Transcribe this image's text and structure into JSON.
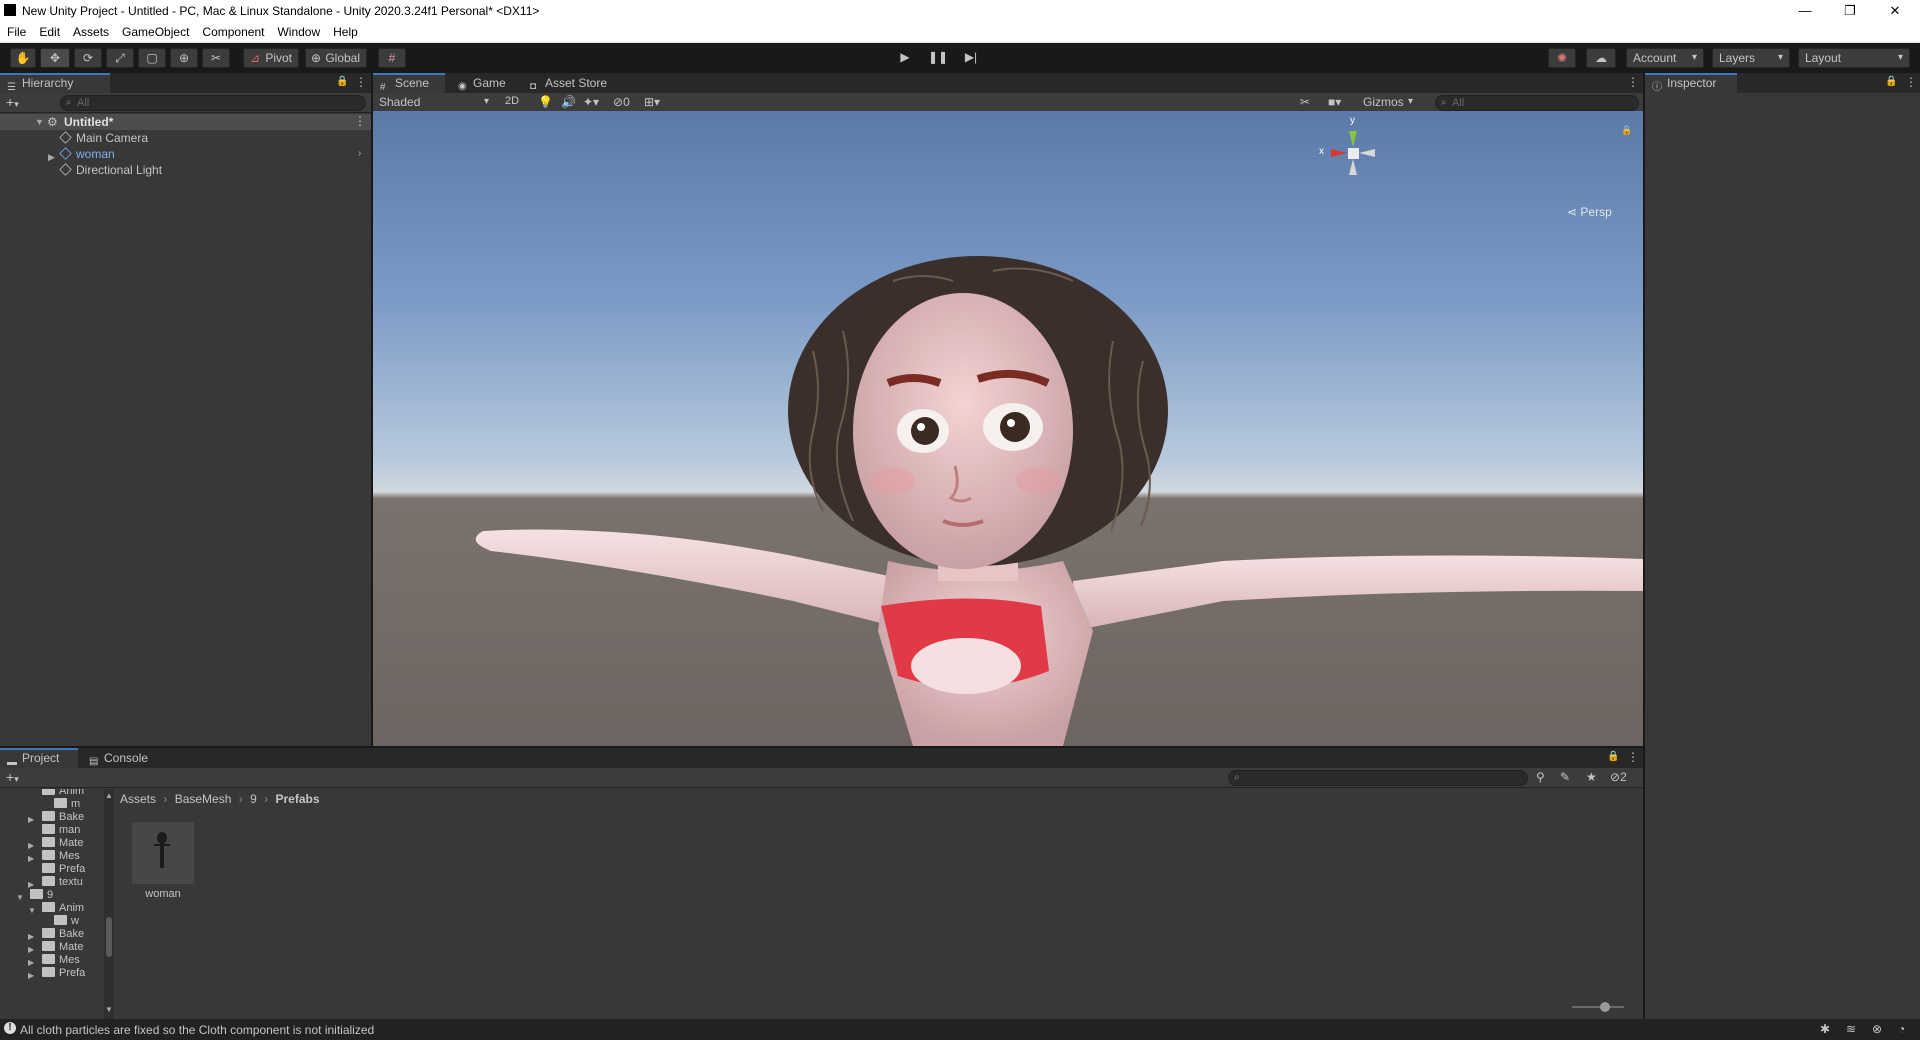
{
  "window": {
    "title": "New Unity Project - Untitled - PC, Mac & Linux Standalone - Unity 2020.3.24f1 Personal* <DX11>",
    "minimize": "—",
    "maximize": "❐",
    "close": "✕"
  },
  "menu": [
    "File",
    "Edit",
    "Assets",
    "GameObject",
    "Component",
    "Window",
    "Help"
  ],
  "toolbar": {
    "pivot_label": "Pivot",
    "global_label": "Global",
    "account_label": "Account",
    "layers_label": "Layers",
    "layout_label": "Layout"
  },
  "hierarchy": {
    "tab_label": "Hierarchy",
    "search_placeholder": "All",
    "scene_name": "Untitled*",
    "items": [
      "Main Camera",
      "woman",
      "Directional Light"
    ]
  },
  "scene": {
    "tabs": [
      "Scene",
      "Game",
      "Asset Store"
    ],
    "shading_mode": "Shaded",
    "mode_2d": "2D",
    "hidden_count": "0",
    "gizmos_label": "Gizmos",
    "search_placeholder": "All",
    "projection_label": "Persp",
    "axis_labels": {
      "x": "x",
      "y": "y"
    }
  },
  "inspector": {
    "tab_label": "Inspector"
  },
  "project": {
    "tabs": [
      "Project",
      "Console"
    ],
    "hidden_count": "2",
    "breadcrumb": [
      "Assets",
      "BaseMesh",
      "9",
      "Prefabs"
    ],
    "tree": [
      {
        "label": "Anim",
        "indent": 3,
        "type": "folder",
        "arrow": ""
      },
      {
        "label": "m",
        "indent": 4,
        "type": "folder",
        "arrow": ""
      },
      {
        "label": "Bake",
        "indent": 3,
        "type": "folder",
        "arrow": "▶"
      },
      {
        "label": "man",
        "indent": 3,
        "type": "folder",
        "arrow": ""
      },
      {
        "label": "Mate",
        "indent": 3,
        "type": "folder",
        "arrow": "▶"
      },
      {
        "label": "Mes",
        "indent": 3,
        "type": "folder",
        "arrow": "▶"
      },
      {
        "label": "Prefa",
        "indent": 3,
        "type": "folder",
        "arrow": ""
      },
      {
        "label": "textu",
        "indent": 3,
        "type": "folder",
        "arrow": "▶"
      },
      {
        "label": "9",
        "indent": 2,
        "type": "folder",
        "arrow": "▼"
      },
      {
        "label": "Anim",
        "indent": 3,
        "type": "folder",
        "arrow": "▼"
      },
      {
        "label": "w",
        "indent": 4,
        "type": "folder",
        "arrow": ""
      },
      {
        "label": "Bake",
        "indent": 3,
        "type": "folder",
        "arrow": "▶"
      },
      {
        "label": "Mate",
        "indent": 3,
        "type": "folder",
        "arrow": "▶"
      },
      {
        "label": "Mes",
        "indent": 3,
        "type": "folder",
        "arrow": "▶"
      },
      {
        "label": "Prefa",
        "indent": 3,
        "type": "folder",
        "arrow": "▶"
      }
    ],
    "assets": [
      {
        "name": "woman"
      }
    ]
  },
  "status": {
    "message": "All cloth particles are fixed so the Cloth component is not initialized"
  },
  "colors": {
    "accent": "#3a79bb",
    "prefab_blue": "#7cb0f0",
    "panel": "#383838",
    "sky_top": "#5b7aa7",
    "ground": "#6d6561"
  }
}
